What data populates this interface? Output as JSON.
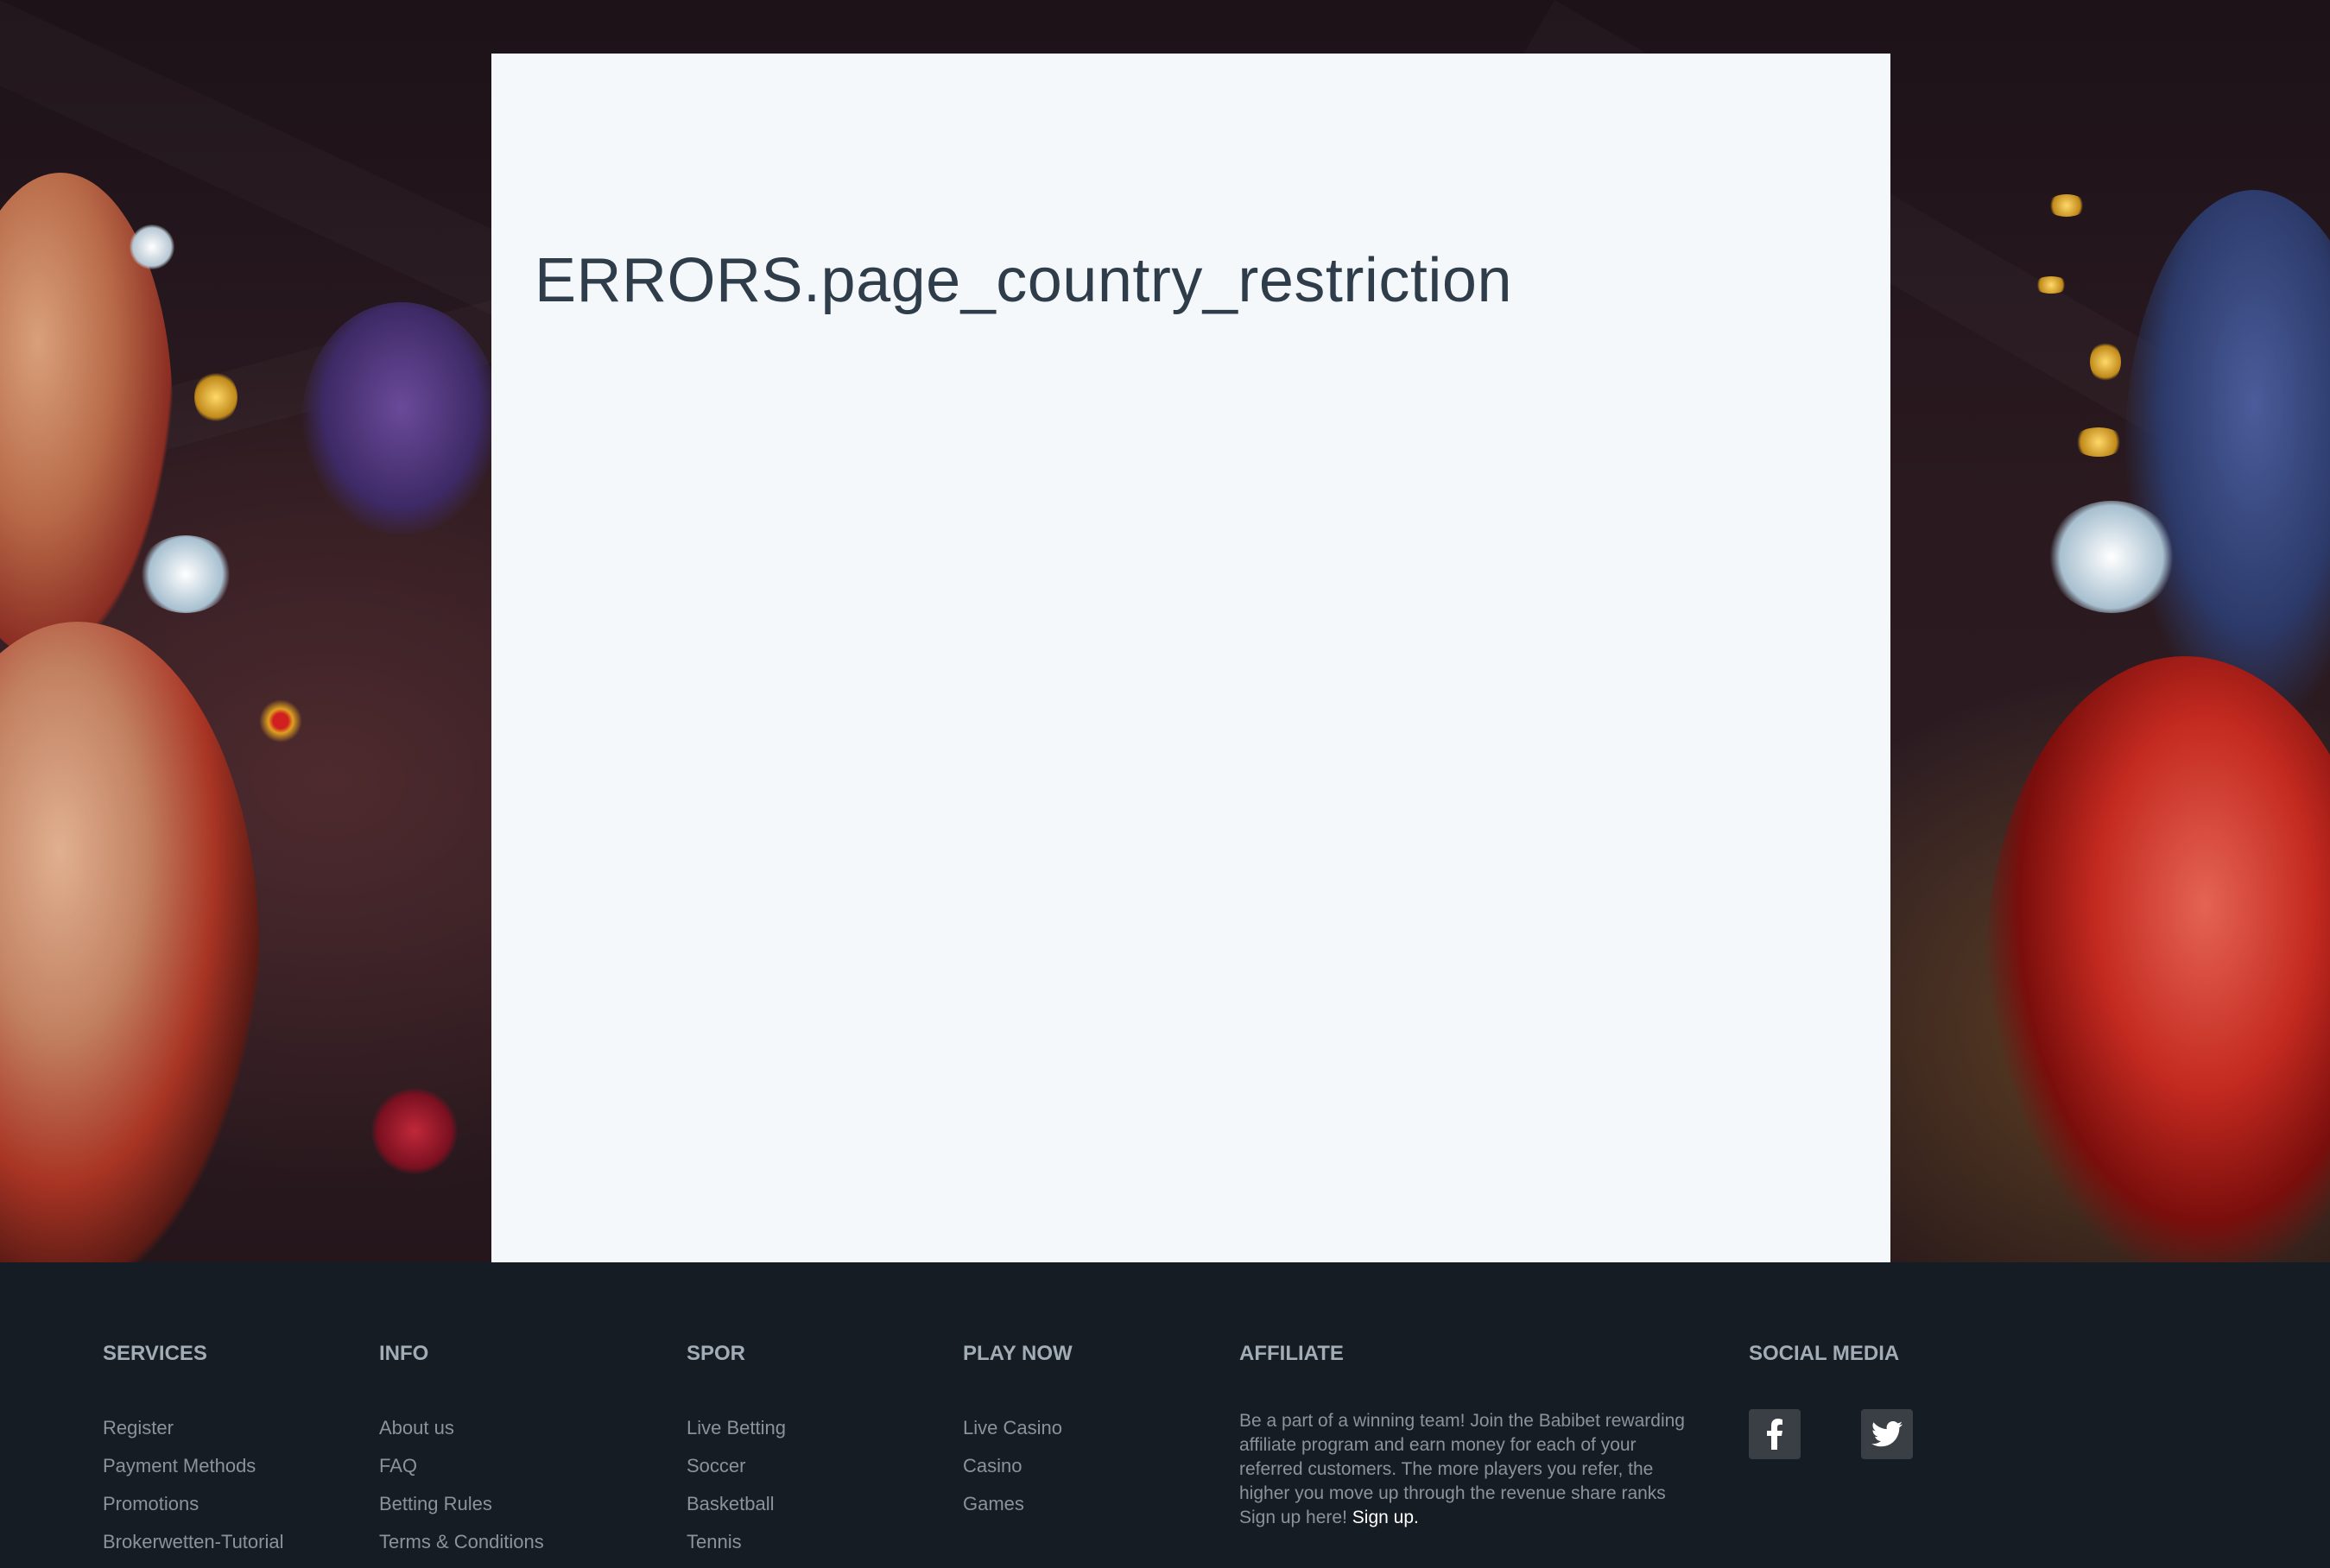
{
  "main": {
    "error_title": "ERRORS.page_country_restriction"
  },
  "footer": {
    "columns": [
      {
        "heading": "SERVICES",
        "links": [
          "Register",
          "Payment Methods",
          "Promotions",
          "Brokerwetten-Tutorial"
        ]
      },
      {
        "heading": "INFO",
        "links": [
          "About us",
          "FAQ",
          "Betting Rules",
          "Terms & Conditions"
        ]
      },
      {
        "heading": "SPOR",
        "links": [
          "Live Betting",
          "Soccer",
          "Basketball",
          "Tennis"
        ]
      },
      {
        "heading": "PLAY NOW",
        "links": [
          "Live Casino",
          "Casino",
          "Games"
        ]
      }
    ],
    "affiliate": {
      "heading": "AFFILIATE",
      "text": "Be a part of a winning team! Join the Babibet rewarding affiliate program and earn money for each of your referred customers. The more players you refer, the higher you move up through the revenue share ranks Sign up here!",
      "signup_label": "Sign up."
    },
    "social": {
      "heading": "SOCIAL MEDIA",
      "icons": [
        "facebook-icon",
        "twitter-icon"
      ]
    }
  },
  "colors": {
    "panel_bg": "#f4f8fb",
    "footer_bg": "#161c23",
    "title_text": "#2f3d4b",
    "footer_link": "#8a939c"
  }
}
